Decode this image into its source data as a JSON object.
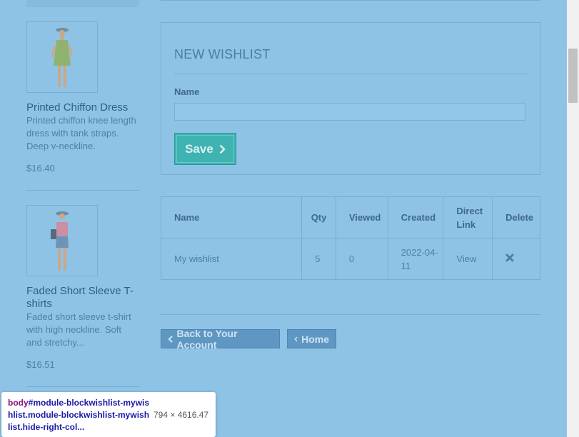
{
  "sidebar": {
    "products": [
      {
        "name": "Printed Chiffon Dress",
        "description": "Printed chiffon knee length dress with tank straps. Deep v-neckline.",
        "price": "$16.40"
      },
      {
        "name": "Faded Short Sleeve T-shirts",
        "description": "Faded short sleeve t-shirt with high neckline. Soft and stretchy...",
        "price": "$16.51"
      }
    ]
  },
  "form": {
    "title": "NEW WISHLIST",
    "name_label": "Name",
    "name_value": "",
    "save_label": "Save"
  },
  "table": {
    "headers": {
      "name": "Name",
      "qty": "Qty",
      "viewed": "Viewed",
      "created": "Created",
      "direct_link": "Direct Link",
      "delete": "Delete"
    },
    "rows": [
      {
        "name": "My wishlist",
        "qty": "5",
        "viewed": "0",
        "created": "2022-04-11",
        "link": "View",
        "delete_icon": "close-icon"
      }
    ]
  },
  "nav": {
    "back_label": "Back to Your Account",
    "home_label": "Home"
  },
  "devtools": {
    "tag": "body",
    "selector": "#module-blockwishlist-mywishlist.module-blockwishlist-mywishlist.hide-right-col...",
    "dimensions": "794 × 4616.47"
  },
  "colors": {
    "page_overlay": "#8ec3e6",
    "save_button": "#3fb3b2",
    "nav_button": "#5f97c2"
  }
}
